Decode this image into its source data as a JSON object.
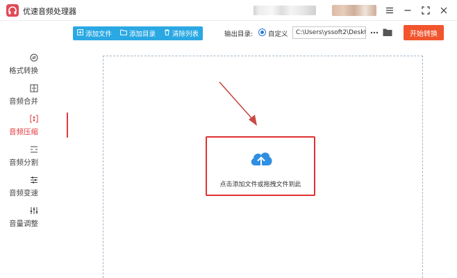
{
  "app": {
    "title": "优速音频处理器",
    "logo_icon": "headphones-icon",
    "accent_color": "#e04a56"
  },
  "window_controls": [
    {
      "icon": "menu-icon"
    },
    {
      "icon": "minimize-icon"
    },
    {
      "icon": "maximize-icon"
    },
    {
      "icon": "close-icon"
    }
  ],
  "toolbar": {
    "buttons": [
      {
        "label": "添加文件",
        "icon": "add-file-icon"
      },
      {
        "label": "添加目录",
        "icon": "folder-icon"
      },
      {
        "label": "清除列表",
        "icon": "clear-list-icon"
      }
    ],
    "button_group_color": "#2aa8e3",
    "output_label": "输出目录:",
    "output_option": "自定义",
    "output_path": "C:\\Users\\yssoft2\\Deskt",
    "more_icon": "more-icon",
    "browse_icon": "folder-open-icon",
    "start_label": "开始转换",
    "start_color": "#f2542d"
  },
  "sidebar": {
    "items": [
      {
        "label": "格式转换",
        "icon": "format-convert-icon",
        "active": false
      },
      {
        "label": "音频合并",
        "icon": "audio-merge-icon",
        "active": false
      },
      {
        "label": "音频压缩",
        "icon": "audio-compress-icon",
        "active": true
      },
      {
        "label": "音频分割",
        "icon": "audio-split-icon",
        "active": false
      },
      {
        "label": "音频变速",
        "icon": "audio-speed-icon",
        "active": false
      },
      {
        "label": "音量调整",
        "icon": "volume-adjust-icon",
        "active": false
      }
    ],
    "active_color": "#e0393e"
  },
  "drop_zone": {
    "hint": "点击添加文件或拖拽文件到此",
    "icon": "cloud-upload-icon",
    "highlight_color": "#e03131"
  }
}
